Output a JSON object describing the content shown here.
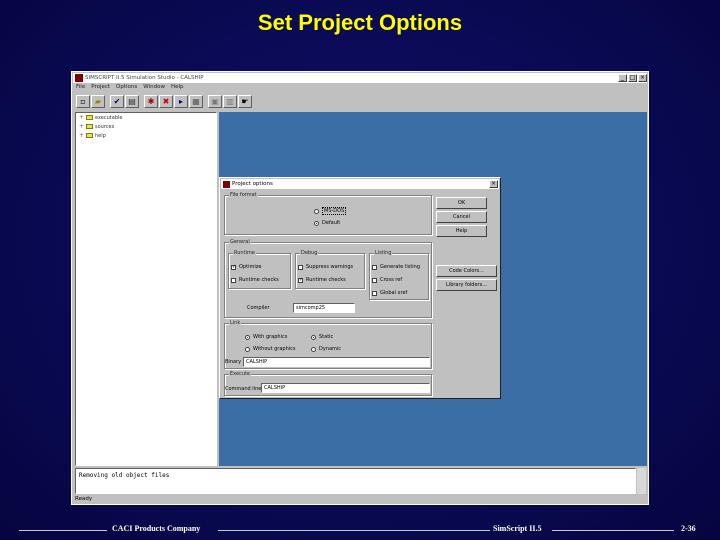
{
  "slide": {
    "title": "Set Project Options"
  },
  "app": {
    "title": "SIMSCRIPT II.5 Simulation Studio - CALSHIP",
    "menus": [
      "File",
      "Project",
      "Options",
      "Window",
      "Help"
    ],
    "window_buttons": {
      "minimize": "_",
      "maximize": "□",
      "close": "×"
    },
    "tree_items": [
      "executable",
      "sources",
      "help"
    ],
    "output_text": "Removing old object files",
    "status_text": "Ready"
  },
  "dialog": {
    "title": "Project options",
    "close_label": "×",
    "buttons": {
      "ok": "OK",
      "cancel": "Cancel",
      "help": "Help",
      "code_colors": "Code Colors...",
      "library_folders": "Library folders..."
    },
    "groups": {
      "file_format": "File format",
      "general": "General",
      "runtime": "Runtime",
      "debug": "Debug",
      "listing": "Listing",
      "link": "Link",
      "execute": "Execute"
    },
    "file_format": {
      "opt1": "MS-DOS",
      "opt2": "Default"
    },
    "runtime": {
      "optimize": "Optimize",
      "runtime_checks": "Runtime checks"
    },
    "debug": {
      "suppress_warnings": "Suppress warnings",
      "runtime_checks": "Runtime checks"
    },
    "listing": {
      "generate_listing": "Generate listing",
      "cross_ref": "Cross ref",
      "global_xref": "Global xref"
    },
    "compiler": {
      "label": "Compiler",
      "value": "simcomp25"
    },
    "link": {
      "with_graphics": "With graphics",
      "without_graphics": "Without graphics",
      "static": "Static",
      "dynamic": "Dynamic"
    },
    "binary": {
      "label": "Binary",
      "value": "CALSHIP"
    },
    "execute": {
      "label": "Command line",
      "value": "CALSHIP"
    }
  },
  "footer": {
    "left": "CACI Products Company",
    "center": "SimScript II.5",
    "right": "2-36"
  }
}
